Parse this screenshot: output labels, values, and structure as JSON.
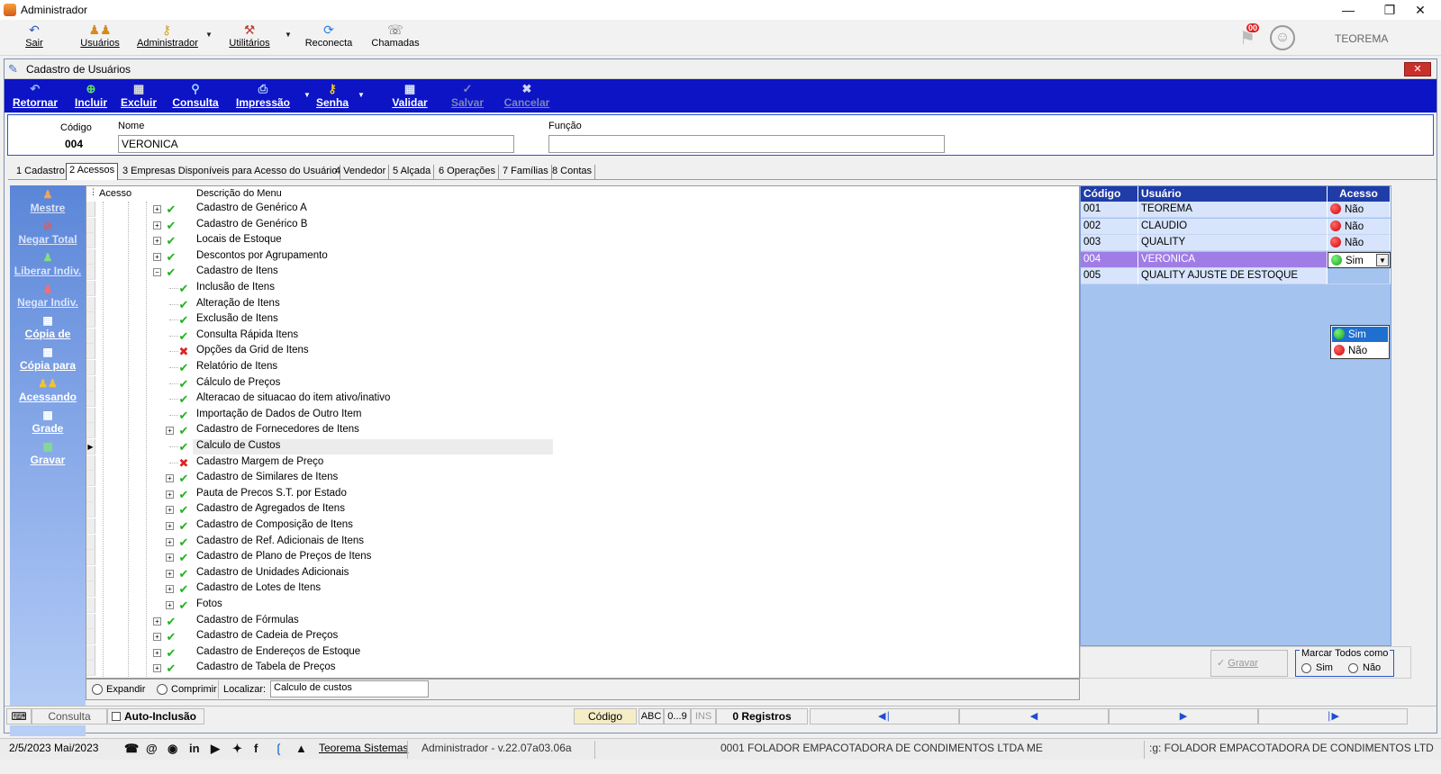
{
  "window": {
    "title": "Administrador"
  },
  "toolbar": {
    "sair": "Sair",
    "usuarios": "Usuários",
    "administrador": "Administrador",
    "utilitarios": "Utilitários",
    "reconecta": "Reconecta",
    "chamadas": "Chamadas",
    "notif_count": "00",
    "company": "TEOREMA"
  },
  "form": {
    "title": "Cadastro de Usuários"
  },
  "actions": {
    "retornar": "Retornar",
    "incluir": "Incluir",
    "excluir": "Excluir",
    "consulta": "Consulta",
    "impressao": "Impressão",
    "senha": "Senha",
    "validar": "Validar",
    "salvar": "Salvar",
    "cancelar": "Cancelar"
  },
  "header": {
    "codigo_label": "Código",
    "codigo_value": "004",
    "nome_label": "Nome",
    "nome_value": "VERONICA",
    "funcao_label": "Função",
    "funcao_value": ""
  },
  "tabs": [
    "1 Cadastro",
    "2 Acessos",
    "3 Empresas Disponíveis para Acesso do Usuário",
    "4 Vendedor",
    "5 Alçada",
    "6 Operações",
    "7 Famílias",
    "8 Contas"
  ],
  "sidebar": [
    "Mestre",
    "Negar Total",
    "Liberar Indiv.",
    "Negar Indiv.",
    "Cópia de",
    "Cópia para",
    "Acessando",
    "Grade",
    "Gravar"
  ],
  "tree": {
    "col_acesso": "Acesso",
    "col_desc": "Descrição do Menu",
    "rows": [
      {
        "label": "Cadastro de Genérico A",
        "level": 1,
        "exp": "+",
        "ok": true
      },
      {
        "label": "Cadastro de Genérico B",
        "level": 1,
        "exp": "+",
        "ok": true
      },
      {
        "label": "Locais de Estoque",
        "level": 1,
        "exp": "+",
        "ok": true
      },
      {
        "label": "Descontos por Agrupamento",
        "level": 1,
        "exp": "+",
        "ok": true
      },
      {
        "label": "Cadastro de Itens",
        "level": 1,
        "exp": "-",
        "ok": true
      },
      {
        "label": "Inclusão de Itens",
        "level": 2,
        "exp": "",
        "ok": true
      },
      {
        "label": "Alteração de Itens",
        "level": 2,
        "exp": "",
        "ok": true
      },
      {
        "label": "Exclusão de Itens",
        "level": 2,
        "exp": "",
        "ok": true
      },
      {
        "label": "Consulta Rápida Itens",
        "level": 2,
        "exp": "",
        "ok": true
      },
      {
        "label": "Opções da Grid de Itens",
        "level": 2,
        "exp": "",
        "ok": false
      },
      {
        "label": "Relatório de Itens",
        "level": 2,
        "exp": "",
        "ok": true
      },
      {
        "label": "Cálculo de Preços",
        "level": 2,
        "exp": "",
        "ok": true
      },
      {
        "label": "Alteracao de situacao do item ativo/inativo",
        "level": 2,
        "exp": "",
        "ok": true
      },
      {
        "label": "Importação de Dados de Outro Item",
        "level": 2,
        "exp": "",
        "ok": true
      },
      {
        "label": "Cadastro de Fornecedores de Itens",
        "level": 2,
        "exp": "+",
        "ok": true
      },
      {
        "label": "Calculo de Custos",
        "level": 2,
        "exp": "",
        "ok": true,
        "current": true
      },
      {
        "label": "Cadastro Margem de Preço",
        "level": 2,
        "exp": "",
        "ok": false
      },
      {
        "label": "Cadastro de Similares de Itens",
        "level": 2,
        "exp": "+",
        "ok": true
      },
      {
        "label": "Pauta de Precos S.T. por Estado",
        "level": 2,
        "exp": "+",
        "ok": true
      },
      {
        "label": "Cadastro de Agregados de Itens",
        "level": 2,
        "exp": "+",
        "ok": true
      },
      {
        "label": "Cadastro de Composição de Itens",
        "level": 2,
        "exp": "+",
        "ok": true
      },
      {
        "label": "Cadastro de Ref. Adicionais de Itens",
        "level": 2,
        "exp": "+",
        "ok": true
      },
      {
        "label": "Cadastro de Plano de Preços de Itens",
        "level": 2,
        "exp": "+",
        "ok": true
      },
      {
        "label": "Cadastro de Unidades Adicionais",
        "level": 2,
        "exp": "+",
        "ok": true
      },
      {
        "label": "Cadastro de Lotes de Itens",
        "level": 2,
        "exp": "+",
        "ok": true
      },
      {
        "label": "Fotos",
        "level": 2,
        "exp": "+",
        "ok": true
      },
      {
        "label": "Cadastro de Fórmulas",
        "level": 1,
        "exp": "+",
        "ok": true
      },
      {
        "label": "Cadastro de Cadeia de Preços",
        "level": 1,
        "exp": "+",
        "ok": true
      },
      {
        "label": "Cadastro de Endereços de Estoque",
        "level": 1,
        "exp": "+",
        "ok": true
      },
      {
        "label": "Cadastro de Tabela de Preços",
        "level": 1,
        "exp": "+",
        "ok": true
      }
    ],
    "expandir": "Expandir",
    "comprimir": "Comprimir",
    "localizar_label": "Localizar:",
    "localizar_value": "Calculo de custos"
  },
  "grid": {
    "col_codigo": "Código",
    "col_usuario": "Usuário",
    "col_acesso": "Acesso",
    "rows": [
      {
        "codigo": "001",
        "usuario": "TEOREMA",
        "acesso": "Não",
        "sim": false
      },
      {
        "codigo": "002",
        "usuario": "CLAUDIO",
        "acesso": "Não",
        "sim": false
      },
      {
        "codigo": "003",
        "usuario": "QUALITY",
        "acesso": "Não",
        "sim": false
      },
      {
        "codigo": "004",
        "usuario": "VERONICA",
        "acesso": "Sim",
        "sim": true,
        "selected": true
      },
      {
        "codigo": "005",
        "usuario": "QUALITY AJUSTE DE ESTOQUE",
        "acesso": "",
        "sim": null
      }
    ],
    "dropdown_options": [
      "Sim",
      "Não"
    ],
    "gravar": "Gravar",
    "marcar_todos": "Marcar Todos como",
    "sim": "Sim",
    "nao": "Não"
  },
  "statusbar": {
    "mode": "Consulta",
    "auto_inclusao": "Auto-Inclusão",
    "codigo": "Código",
    "abc": "ABC",
    "digits": "0...9",
    "ins": "INS",
    "registros": "0 Registros"
  },
  "taskbar": {
    "date": "2/5/2023 Mai/2023",
    "company_link": "Teorema Sistemas",
    "version": "Administrador - v.22.07a03.06a",
    "empresa": "0001 FOLADOR EMPACOTADORA DE CONDIMENTOS LTDA ME",
    "empresa_scroll": ":g: FOLADOR EMPACOTADORA DE CONDIMENTOS LTD"
  }
}
